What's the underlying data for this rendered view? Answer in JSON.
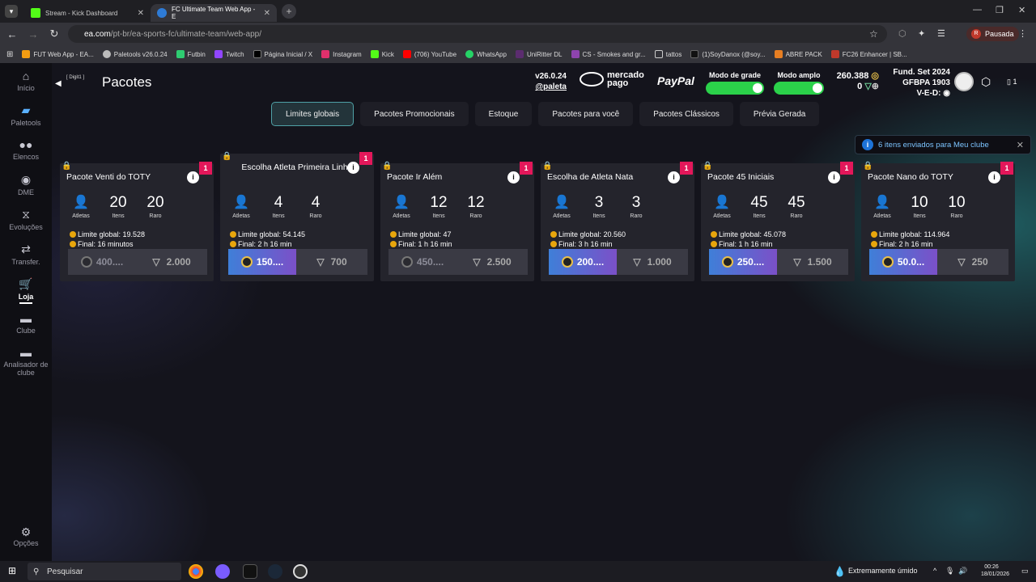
{
  "browser": {
    "tabs": [
      {
        "label": "Stream - Kick Dashboard",
        "active": false
      },
      {
        "label": "FC Ultimate Team Web App - E",
        "active": true
      }
    ],
    "url_domain": "ea.com",
    "url_path": "/pt-br/ea-sports-fc/ultimate-team/web-app/",
    "profile": "Pausada",
    "bookmarks": [
      "FUT Web App - EA...",
      "Paletools v26.0.24",
      "Futbin",
      "Twitch",
      "Página Inicial / X",
      "Instagram",
      "Kick",
      "(706) YouTube",
      "WhatsApp",
      "UniRitter DL",
      "CS - Smokes and gr...",
      "tattos",
      "(1)SoyDanox (@soy...",
      "ABRE PACK",
      "FC26 Enhancer | SB..."
    ]
  },
  "sidebar": {
    "items": [
      {
        "label": "Início",
        "icon": "home-icon"
      },
      {
        "label": "Paletools",
        "icon": "paletools-icon"
      },
      {
        "label": "Elencos",
        "icon": "squad-icon"
      },
      {
        "label": "DME",
        "icon": "dme-icon"
      },
      {
        "label": "Evoluções",
        "icon": "evolution-icon"
      },
      {
        "label": "Transfer.",
        "icon": "transfer-icon"
      },
      {
        "label": "Loja",
        "icon": "cart-icon"
      },
      {
        "label": "Clube",
        "icon": "club-icon"
      },
      {
        "label": "Analisador de clube",
        "icon": "analyzer-icon"
      }
    ],
    "options": "Opções"
  },
  "header": {
    "digit": "[ Digit1 ]",
    "title": "Pacotes",
    "version": "v26.0.24",
    "handle": "@paleta",
    "mercado_line1": "mercado",
    "mercado_line2": "pago",
    "paypal": "PayPal",
    "grid_mode": "Modo de grade",
    "wide_mode": "Modo amplo",
    "coins": "260.388",
    "points": "0",
    "club_line1": "Fund. Set 2024",
    "club_line2": "GFBPA 1903",
    "club_line3": "V-E-D:",
    "devices": "1"
  },
  "pack_tabs": [
    "Limites globais",
    "Pacotes Promocionais",
    "Estoque",
    "Pacotes para você",
    "Pacotes Clássicos",
    "Prévia Gerada"
  ],
  "notification": "6 itens enviados para Meu clube",
  "labels": {
    "athletes": "Atletas",
    "items": "Itens",
    "rare": "Raro"
  },
  "packs": [
    {
      "name": "Pacote Venti do TOTY",
      "count": "1",
      "items": "20",
      "rare": "20",
      "limit": "Limite global: 19.528",
      "final": "Final: 16 minutos",
      "coins": "400....",
      "points": "2.000",
      "highlight": false
    },
    {
      "name": "Escolha Atleta Primeira Linha",
      "count": "1",
      "items": "4",
      "rare": "4",
      "limit": "Limite global: 54.145",
      "final": "Final: 2 h 16 min",
      "coins": "150....",
      "points": "700",
      "highlight": true
    },
    {
      "name": "Pacote Ir Além",
      "count": "1",
      "items": "12",
      "rare": "12",
      "limit": "Limite global: 47",
      "final": "Final: 1 h 16 min",
      "coins": "450....",
      "points": "2.500",
      "highlight": false
    },
    {
      "name": "Escolha de Atleta Nata",
      "count": "1",
      "items": "3",
      "rare": "3",
      "limit": "Limite global: 20.560",
      "final": "Final: 3 h 16 min",
      "coins": "200....",
      "points": "1.000",
      "highlight": true
    },
    {
      "name": "Pacote 45 Iniciais",
      "count": "1",
      "items": "45",
      "rare": "45",
      "limit": "Limite global: 45.078",
      "final": "Final: 1 h 16 min",
      "coins": "250....",
      "points": "1.500",
      "highlight": true
    },
    {
      "name": "Pacote Nano do TOTY",
      "count": "1",
      "items": "10",
      "rare": "10",
      "limit": "Limite global: 114.964",
      "final": "Final: 2 h 16 min",
      "coins": "50.0...",
      "points": "250",
      "highlight": true
    }
  ],
  "taskbar": {
    "search": "Pesquisar",
    "weather": "Extremamente úmido",
    "time": "00:26",
    "date": "18/01/2026"
  }
}
